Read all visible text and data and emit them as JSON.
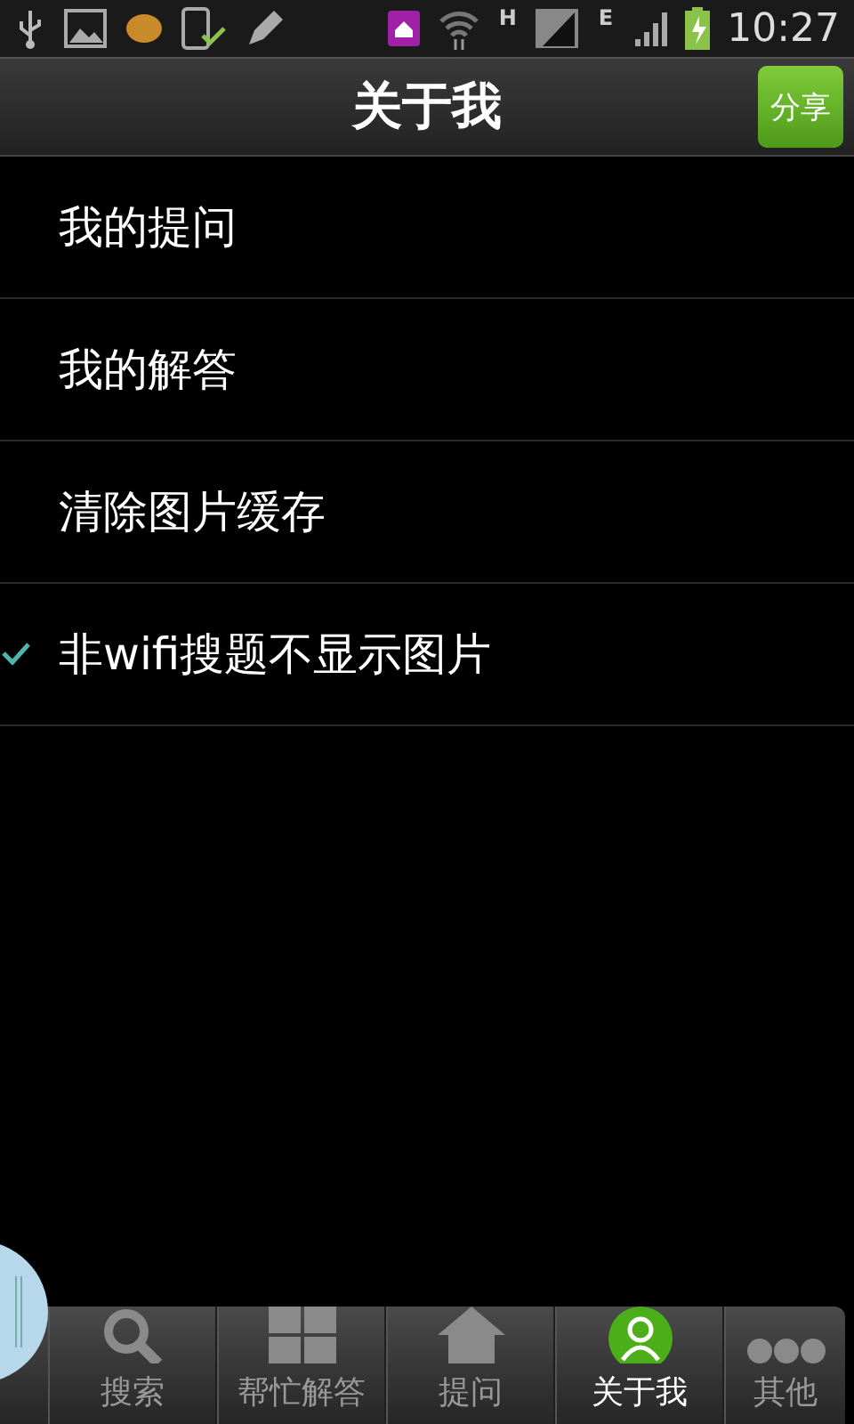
{
  "status_bar": {
    "network_labels": [
      "H",
      "E"
    ],
    "time": "10:27"
  },
  "title_bar": {
    "title": "关于我",
    "share_button": "分享"
  },
  "settings": [
    {
      "label": "我的提问",
      "kind": "plain"
    },
    {
      "label": "我的解答",
      "kind": "plain"
    },
    {
      "label": "清除图片缓存",
      "kind": "plain"
    },
    {
      "label": "非wifi搜题不显示图片",
      "kind": "check",
      "checked": true
    }
  ],
  "tabs": [
    {
      "label": "搜索",
      "selected": false
    },
    {
      "label": "帮忙解答",
      "selected": false
    },
    {
      "label": "提问",
      "selected": false
    },
    {
      "label": "关于我",
      "selected": true
    },
    {
      "label": "其他",
      "selected": false
    }
  ]
}
